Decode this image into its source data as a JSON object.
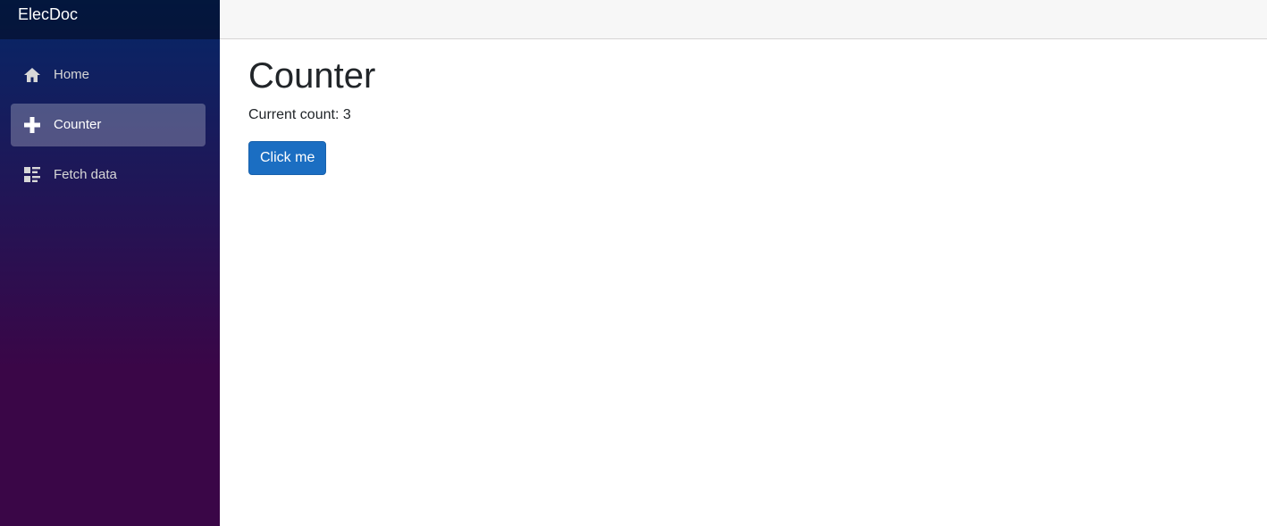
{
  "app": {
    "brand": "ElecDoc"
  },
  "sidebar": {
    "items": [
      {
        "label": "Home",
        "icon": "home-icon",
        "active": false
      },
      {
        "label": "Counter",
        "icon": "plus-icon",
        "active": true
      },
      {
        "label": "Fetch data",
        "icon": "list-icon",
        "active": false
      }
    ]
  },
  "main": {
    "title": "Counter",
    "count_label": "Current count:",
    "count_value": "3",
    "button_label": "Click me"
  },
  "colors": {
    "sidebar_gradient_top": "#052767",
    "sidebar_gradient_bottom": "#3a0647",
    "button_primary": "#1b6ec2",
    "top_row_bg": "#f7f7f7"
  }
}
